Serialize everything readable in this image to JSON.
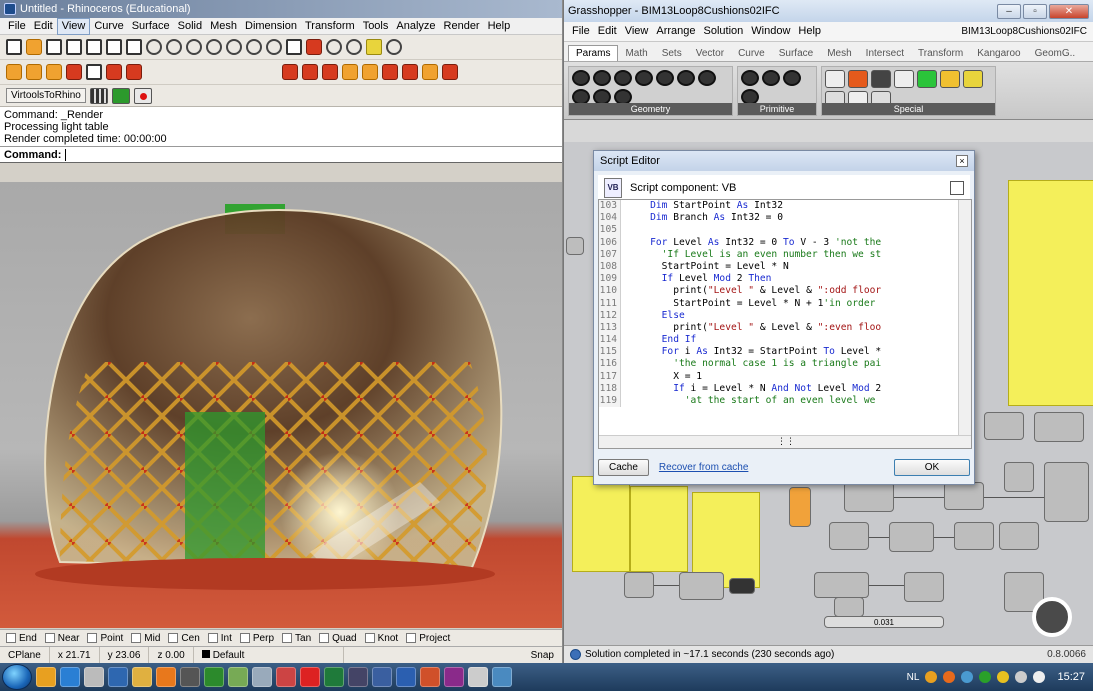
{
  "rhino": {
    "title": "Untitled - Rhinoceros (Educational)",
    "menu": [
      "File",
      "Edit",
      "View",
      "Curve",
      "Surface",
      "Solid",
      "Mesh",
      "Dimension",
      "Transform",
      "Tools",
      "Analyze",
      "Render",
      "Help"
    ],
    "active_menu": "View",
    "plugin_toolbar_label": "VirtoolsToRhino",
    "command_history": [
      "Command: _Render",
      "Processing light table",
      "Render completed time: 00:00:00"
    ],
    "command_prompt": "Command:",
    "osnaps": [
      "End",
      "Near",
      "Point",
      "Mid",
      "Cen",
      "Int",
      "Perp",
      "Tan",
      "Quad",
      "Knot",
      "Project"
    ],
    "status": {
      "cplane": "CPlane",
      "x": "x 21.71",
      "y": "y 23.06",
      "z": "z 0.00",
      "layer": "Default",
      "snap": "Snap"
    }
  },
  "grasshopper": {
    "title": "Grasshopper - BIM13Loop8Cushions02IFC",
    "menu": [
      "File",
      "Edit",
      "View",
      "Arrange",
      "Solution",
      "Window",
      "Help"
    ],
    "document_name": "BIM13Loop8Cushions02IFC",
    "tabs": [
      "Params",
      "Math",
      "Sets",
      "Vector",
      "Curve",
      "Surface",
      "Mesh",
      "Intersect",
      "Transform",
      "Kangaroo",
      "GeomG.."
    ],
    "active_tab": "Params",
    "ribbon_groups": [
      "Geometry",
      "Primitive",
      "Special"
    ],
    "status_message": "Solution completed in ~17.1 seconds (230 seconds ago)",
    "version": "0.8.0066",
    "slider_value": "0.031"
  },
  "script_editor": {
    "title": "Script Editor",
    "component_label": "Script component: VB",
    "badge": "VB",
    "lines": [
      {
        "n": "103",
        "html": "    <span class=\"kw\">Dim</span> StartPoint <span class=\"kw\">As</span> Int32"
      },
      {
        "n": "104",
        "html": "    <span class=\"kw\">Dim</span> Branch <span class=\"kw\">As</span> Int32 = 0"
      },
      {
        "n": "105",
        "html": ""
      },
      {
        "n": "106",
        "html": "    <span class=\"kw\">For</span> Level <span class=\"kw\">As</span> Int32 = 0 <span class=\"kw\">To</span> V - 3 <span class=\"cm\">'not the</span>"
      },
      {
        "n": "107",
        "html": "      <span class=\"cm\">'If Level is an even number then we st</span>"
      },
      {
        "n": "108",
        "html": "      StartPoint = Level * N"
      },
      {
        "n": "109",
        "html": "      <span class=\"kw\">If</span> Level <span class=\"kw\">Mod</span> 2 <span class=\"kw\">Then</span>"
      },
      {
        "n": "110",
        "html": "        print(<span class=\"str\">\"Level \"</span> &amp; Level &amp; <span class=\"str\">\":odd floor</span>"
      },
      {
        "n": "111",
        "html": "        StartPoint = Level * N + 1<span class=\"cm\">'in order</span>"
      },
      {
        "n": "112",
        "html": "      <span class=\"kw\">Else</span>"
      },
      {
        "n": "113",
        "html": "        print(<span class=\"str\">\"Level \"</span> &amp; Level &amp; <span class=\"str\">\":even floo</span>"
      },
      {
        "n": "114",
        "html": "      <span class=\"kw\">End If</span>"
      },
      {
        "n": "115",
        "html": "      <span class=\"kw\">For</span> i <span class=\"kw\">As</span> Int32 = StartPoint <span class=\"kw\">To</span> Level *"
      },
      {
        "n": "116",
        "html": "        <span class=\"cm\">'the normal case 1 is a triangle pai</span>"
      },
      {
        "n": "117",
        "html": "        X = 1"
      },
      {
        "n": "118",
        "html": "        <span class=\"kw\">If</span> i = Level * N <span class=\"kw\">And Not</span> Level <span class=\"kw\">Mod</span> 2"
      },
      {
        "n": "119",
        "html": "          <span class=\"cm\">'at the start of an even level we</span>"
      }
    ],
    "cache_button": "Cache",
    "recover_link": "Recover from cache",
    "ok_button": "OK"
  },
  "taskbar": {
    "language": "NL",
    "clock": "15:27"
  },
  "colors": {
    "accent_blue": "#1a2bd1",
    "viewport_floor": "#c0482f",
    "gh_panel_yellow": "#f4ef5a"
  }
}
